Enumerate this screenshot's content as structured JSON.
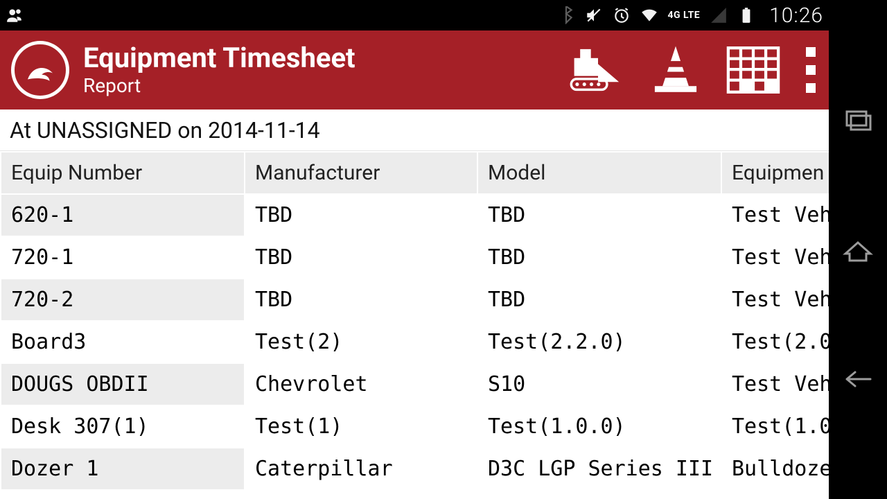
{
  "status": {
    "time": "10:26",
    "network_label": "4G LTE"
  },
  "header": {
    "title": "Equipment Timesheet",
    "subtitle": "Report"
  },
  "context": "At UNASSIGNED on 2014-11-14",
  "table": {
    "columns": [
      "Equip Number",
      "Manufacturer",
      "Model",
      "Equipmen"
    ],
    "rows": [
      {
        "equip": "620-1",
        "manu": "TBD",
        "model": "TBD",
        "desc": "Test Veh"
      },
      {
        "equip": "720-1",
        "manu": "TBD",
        "model": "TBD",
        "desc": "Test Veh"
      },
      {
        "equip": "720-2",
        "manu": "TBD",
        "model": "TBD",
        "desc": "Test Veh"
      },
      {
        "equip": "Board3",
        "manu": "Test(2)",
        "model": "Test(2.2.0)",
        "desc": "Test(2.0"
      },
      {
        "equip": "DOUGS OBDII",
        "manu": "Chevrolet",
        "model": "S10",
        "desc": "Test Veh"
      },
      {
        "equip": "Desk 307(1)",
        "manu": "Test(1)",
        "model": "Test(1.0.0)",
        "desc": "Test(1.0"
      },
      {
        "equip": "Dozer 1",
        "manu": "Caterpillar",
        "model": "D3C LGP Series III",
        "desc": "Bulldoze"
      }
    ]
  }
}
